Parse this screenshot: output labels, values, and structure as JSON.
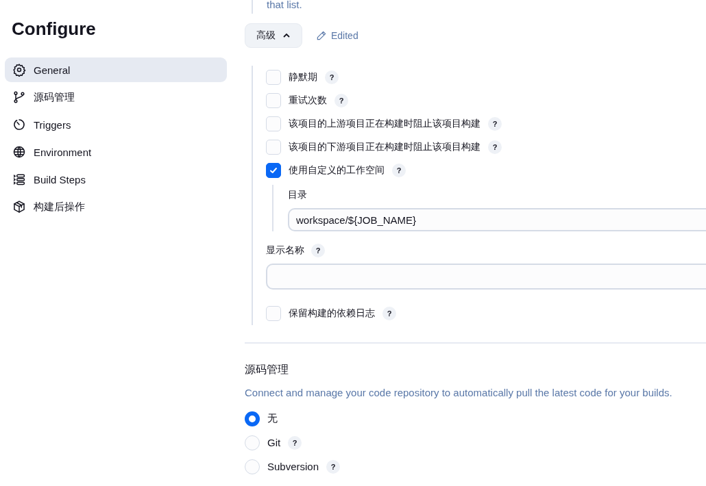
{
  "intro_text": "that list.",
  "sidebar": {
    "title": "Configure",
    "items": [
      {
        "label": "General",
        "selected": true
      },
      {
        "label": "源码管理",
        "selected": false
      },
      {
        "label": "Triggers",
        "selected": false
      },
      {
        "label": "Environment",
        "selected": false
      },
      {
        "label": "Build Steps",
        "selected": false
      },
      {
        "label": "构建后操作",
        "selected": false
      }
    ]
  },
  "advanced": {
    "label": "高级",
    "expanded": true,
    "edited_label": "Edited"
  },
  "options": [
    {
      "kind": "checkbox",
      "label": "静默期",
      "checked": false,
      "help": "?"
    },
    {
      "kind": "checkbox",
      "label": "重试次数",
      "checked": false,
      "help": "?"
    },
    {
      "kind": "checkbox",
      "label": "该项目的上游项目正在构建时阻止该项目构建",
      "checked": false,
      "help": "?"
    },
    {
      "kind": "checkbox",
      "label": "该项目的下游项目正在构建时阻止该项目构建",
      "checked": false,
      "help": "?"
    },
    {
      "kind": "checkbox",
      "label": "使用自定义的工作空间",
      "checked": true,
      "help": "?",
      "field": {
        "label": "目录",
        "value": "workspace/${JOB_NAME}"
      }
    },
    {
      "kind": "text",
      "label": "显示名称",
      "help": "?"
    },
    {
      "kind": "checkbox",
      "label": "保留构建的依赖日志",
      "checked": false,
      "help": "?"
    }
  ],
  "scm": {
    "title": "源码管理",
    "description": "Connect and manage your code repository to automatically pull the latest code for your builds.",
    "options": [
      {
        "label": "无",
        "selected": true
      },
      {
        "label": "Git",
        "selected": false,
        "help": "?"
      },
      {
        "label": "Subversion",
        "selected": false,
        "help": "?"
      }
    ]
  }
}
